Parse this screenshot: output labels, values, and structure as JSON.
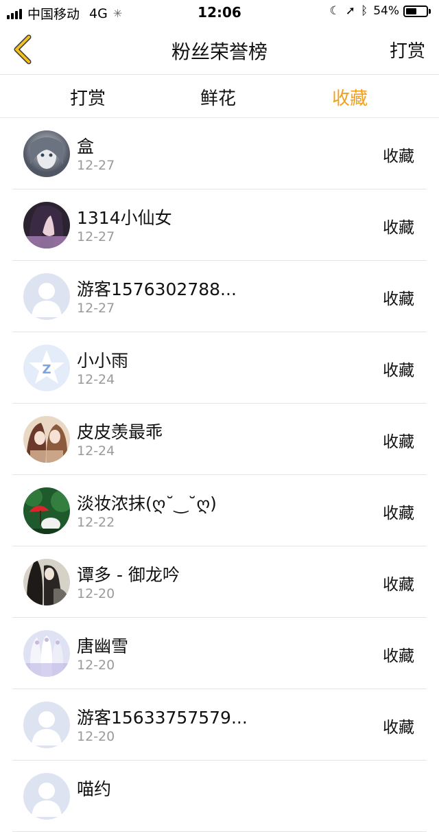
{
  "status": {
    "carrier": "中国移动",
    "network": "4G",
    "time": "12:06",
    "battery": "54%",
    "battery_level": 0.54
  },
  "nav": {
    "title": "粉丝荣誉榜",
    "right": "打赏"
  },
  "tabs": [
    {
      "label": "打赏",
      "active": false
    },
    {
      "label": "鲜花",
      "active": false
    },
    {
      "label": "收藏",
      "active": true
    }
  ],
  "accent_color": "#f0a01e",
  "rows": [
    {
      "name": "盒",
      "date": "12-27",
      "action": "收藏",
      "avatar": "anime-girl"
    },
    {
      "name": "1314小仙女",
      "date": "12-27",
      "action": "收藏",
      "avatar": "purple-girl"
    },
    {
      "name": "游客1576302788...",
      "date": "12-27",
      "action": "收藏",
      "avatar": "default-user"
    },
    {
      "name": "小小雨",
      "date": "12-24",
      "action": "收藏",
      "avatar": "qq-star"
    },
    {
      "name": "皮皮羡最乖",
      "date": "12-24",
      "action": "收藏",
      "avatar": "anime-couple"
    },
    {
      "name": "淡妆浓抹(ღ˘‿˘ღ)",
      "date": "12-22",
      "action": "收藏",
      "avatar": "red-umbrella"
    },
    {
      "name": "谭多 - 御龙吟",
      "date": "12-20",
      "action": "收藏",
      "avatar": "dark-warrior"
    },
    {
      "name": "唐幽雪",
      "date": "12-20",
      "action": "收藏",
      "avatar": "white-fairies"
    },
    {
      "name": "游客15633757579...",
      "date": "12-20",
      "action": "收藏",
      "avatar": "default-user"
    },
    {
      "name": "喵约",
      "date": "",
      "action": "",
      "avatar": "default-user"
    }
  ]
}
